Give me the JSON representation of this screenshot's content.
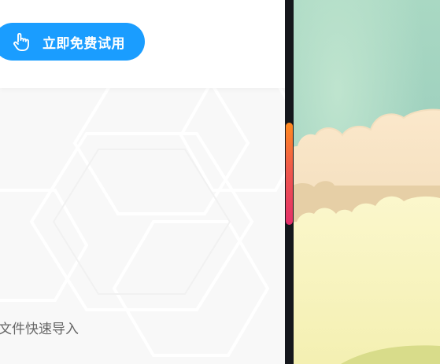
{
  "header": {
    "trial_button_label": "立即免费试用",
    "trial_button_icon": "pointing-hand-icon",
    "button_color": "#1a9dff"
  },
  "content": {
    "import_text": "文件快速导入"
  },
  "scrollbar": {
    "thumb_colors": [
      "#ff8a1f",
      "#e42f6a"
    ]
  },
  "illustration": {
    "subject": "clouds-over-hill",
    "sky_color": "#9fd0bd",
    "cloud_color": "#f6e3c2",
    "hill_color": "#f6f3b8"
  }
}
